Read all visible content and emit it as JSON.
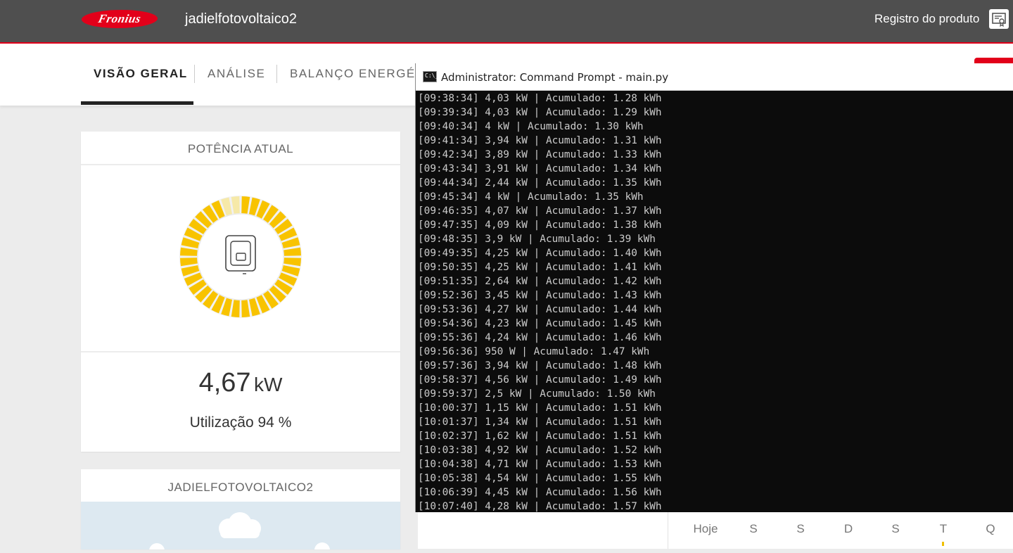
{
  "header": {
    "logo_text": "Fronius",
    "site_name": "jadielfotovoltaico2",
    "product_registration": "Registro do produto"
  },
  "nav": {
    "tabs": [
      "VISÃO GERAL",
      "ANÁLISE",
      "BALANÇO ENERGÉT"
    ]
  },
  "power_card": {
    "title": "POTÊNCIA ATUAL",
    "value": "4,67",
    "unit": "kW",
    "utilization_label": "Utilização",
    "utilization_value": "94 %",
    "utilization_fraction": 0.94,
    "gauge_color": "#f8c300",
    "gauge_empty_color": "#f6e9a8"
  },
  "site_card": {
    "title": "JADIELFOTOVOLTAICO2"
  },
  "weather": {
    "days": [
      "Hoje",
      "S",
      "S",
      "D",
      "S",
      "T",
      "Q"
    ]
  },
  "cmd": {
    "title": "Administrator: Command Prompt - main.py",
    "lines": [
      "[09:38:34] 4,03 kW | Acumulado: 1.28 kWh",
      "[09:39:34] 4,03 kW | Acumulado: 1.29 kWh",
      "[09:40:34] 4 kW | Acumulado: 1.30 kWh",
      "[09:41:34] 3,94 kW | Acumulado: 1.31 kWh",
      "[09:42:34] 3,89 kW | Acumulado: 1.33 kWh",
      "[09:43:34] 3,91 kW | Acumulado: 1.34 kWh",
      "[09:44:34] 2,44 kW | Acumulado: 1.35 kWh",
      "[09:45:34] 4 kW | Acumulado: 1.35 kWh",
      "[09:46:35] 4,07 kW | Acumulado: 1.37 kWh",
      "[09:47:35] 4,09 kW | Acumulado: 1.38 kWh",
      "[09:48:35] 3,9 kW | Acumulado: 1.39 kWh",
      "[09:49:35] 4,25 kW | Acumulado: 1.40 kWh",
      "[09:50:35] 4,25 kW | Acumulado: 1.41 kWh",
      "[09:51:35] 2,64 kW | Acumulado: 1.42 kWh",
      "[09:52:36] 3,45 kW | Acumulado: 1.43 kWh",
      "[09:53:36] 4,27 kW | Acumulado: 1.44 kWh",
      "[09:54:36] 4,23 kW | Acumulado: 1.45 kWh",
      "[09:55:36] 4,24 kW | Acumulado: 1.46 kWh",
      "[09:56:36] 950 W | Acumulado: 1.47 kWh",
      "[09:57:36] 3,94 kW | Acumulado: 1.48 kWh",
      "[09:58:37] 4,56 kW | Acumulado: 1.49 kWh",
      "[09:59:37] 2,5 kW | Acumulado: 1.50 kWh",
      "[10:00:37] 1,15 kW | Acumulado: 1.51 kWh",
      "[10:01:37] 1,34 kW | Acumulado: 1.51 kWh",
      "[10:02:37] 1,62 kW | Acumulado: 1.51 kWh",
      "[10:03:38] 4,92 kW | Acumulado: 1.52 kWh",
      "[10:04:38] 4,71 kW | Acumulado: 1.53 kWh",
      "[10:05:38] 4,54 kW | Acumulado: 1.55 kWh",
      "[10:06:39] 4,45 kW | Acumulado: 1.56 kWh",
      "[10:07:40] 4,28 kW | Acumulado: 1.57 kWh"
    ]
  }
}
